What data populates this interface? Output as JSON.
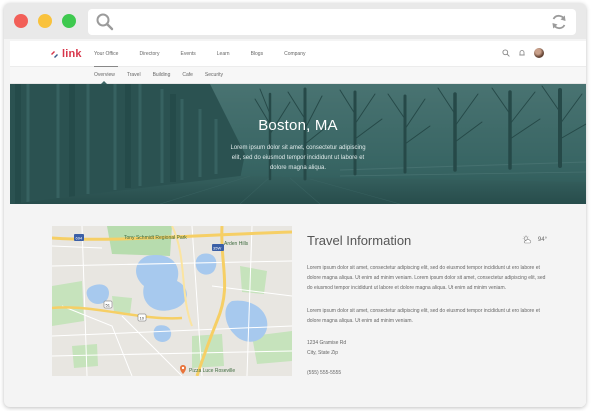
{
  "browser": {
    "url": ""
  },
  "nav": {
    "logo_text": "link",
    "items": [
      {
        "label": "Your Office",
        "active": true
      },
      {
        "label": "Directory",
        "active": false
      },
      {
        "label": "Events",
        "active": false
      },
      {
        "label": "Learn",
        "active": false
      },
      {
        "label": "Blogs",
        "active": false
      },
      {
        "label": "Company",
        "active": false
      }
    ],
    "icons": [
      "search-icon",
      "bell-icon",
      "avatar"
    ]
  },
  "subnav": {
    "items": [
      {
        "label": "Overview",
        "active": true
      },
      {
        "label": "Travel",
        "active": false
      },
      {
        "label": "Building",
        "active": false
      },
      {
        "label": "Cafe",
        "active": false
      },
      {
        "label": "Security",
        "active": false
      }
    ]
  },
  "hero": {
    "title": "Boston, MA",
    "text": "Lorem ipsum dolor sit amet, consectetur adipiscing elit, sed do eiusmod tempor incididunt ut labore et dolore magna aliqua."
  },
  "map": {
    "labels": {
      "park": "Tony Schmidt Regional Park",
      "hills": "Arden Hills",
      "pizza": "Pizza Luce Roseville",
      "hwy1": "694",
      "hwy2": "51",
      "hwy3": "35W",
      "hwy4": "10"
    }
  },
  "info": {
    "title": "Travel Information",
    "weather_icon": "sun-cloud-icon",
    "temperature": "94°",
    "paragraph1": "Lorem ipsum dolor sit amet, consectetur adipiscing elit, sed do eiusmod tempor incididunt ut ero labore et dolore magna aliqua. Ut enim ad minim veniam. Lorem ipsum dolor sit amet, consectetur adipiscing elit, sed do eiusmod tempor incididunt ut labore et dolore magna aliqua. Ut enim ad minim veniam.",
    "paragraph2": "Lorem ipsum dolor sit amet, consectetur adipiscing elit, sed do eiusmod tempor incididunt ut ero labore et dolore magna aliqua. Ut enim ad minim veniam.",
    "address_line1": "1234 Gramise Rd",
    "address_line2": "City, State Zip",
    "phone": "(555) 555-5555"
  },
  "colors": {
    "brand_red": "#d8354a",
    "hero_teal": "#2f5d5c",
    "dot_red": "#f25f58",
    "dot_yellow": "#f9c23c",
    "dot_green": "#3ec94f"
  }
}
